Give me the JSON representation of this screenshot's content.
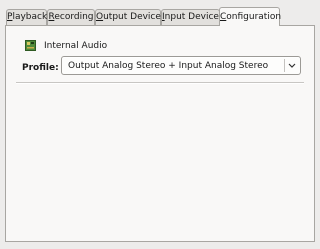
{
  "tabs": [
    {
      "label": "Playback",
      "underline": "P",
      "rest": "layback"
    },
    {
      "label": "Recording",
      "underline": "R",
      "rest": "ecording"
    },
    {
      "label": "Output Devices",
      "underline": "O",
      "rest": "utput Devices"
    },
    {
      "label": "Input Devices",
      "underline": "I",
      "rest": "nput Devices"
    },
    {
      "label": "Configuration",
      "underline": "C",
      "rest": "onfiguration"
    }
  ],
  "active_tab": "Configuration",
  "card": {
    "name": "Internal Audio",
    "icon": "sound-card-icon"
  },
  "profile": {
    "label": "Profile:",
    "selected": "Output Analog Stereo + Input Analog Stereo"
  },
  "colors": {
    "accent": "#6a8fc0",
    "panel": "#f9f8f7",
    "window": "#edeceb"
  }
}
